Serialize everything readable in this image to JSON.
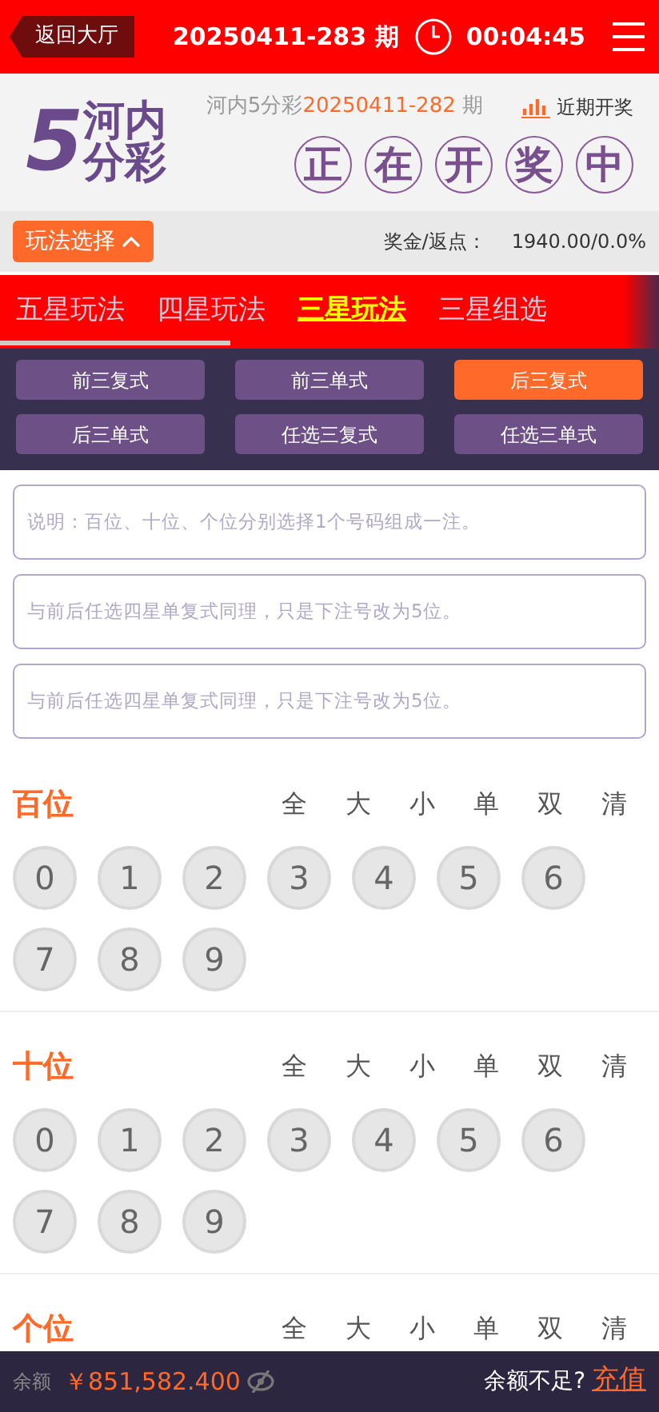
{
  "header": {
    "back": "返回大厅",
    "issue": "20250411-283 期",
    "countdown": "00:04:45"
  },
  "info": {
    "logo_digit": "5",
    "logo_top": "河内",
    "logo_bottom": "分彩",
    "lottery": "河内5分彩",
    "last_issue": "20250411-282",
    "last_suffix": " 期",
    "history": "近期开奖",
    "drawing": [
      "正",
      "在",
      "开",
      "奖",
      "中"
    ]
  },
  "bar": {
    "play_select": "玩法选择",
    "expanded": true,
    "prize_label": "奖金/返点：",
    "prize_value": "1940.00/0.0%"
  },
  "tabs": [
    {
      "label": "五星玩法",
      "selected": false
    },
    {
      "label": "四星玩法",
      "selected": false
    },
    {
      "label": "三星玩法",
      "selected": true
    },
    {
      "label": "三星组选",
      "selected": false
    }
  ],
  "subtypes": [
    {
      "label": "前三复式",
      "selected": false
    },
    {
      "label": "前三单式",
      "selected": false
    },
    {
      "label": "后三复式",
      "selected": true
    },
    {
      "label": "后三单式",
      "selected": false
    },
    {
      "label": "任选三复式",
      "selected": false
    },
    {
      "label": "任选三单式",
      "selected": false
    }
  ],
  "notes": [
    "说明：百位、十位、个位分别选择1个号码组成一注。",
    "与前后任选四星单复式同理，只是下注号改为5位。",
    "与前后任选四星单复式同理，只是下注号改为5位。"
  ],
  "positions": [
    {
      "title": "百位",
      "filters": [
        "全",
        "大",
        "小",
        "单",
        "双",
        "清"
      ],
      "digits": [
        {
          "label": "0",
          "selected": false
        },
        {
          "label": "1",
          "selected": false
        },
        {
          "label": "2",
          "selected": false
        },
        {
          "label": "3",
          "selected": false
        },
        {
          "label": "4",
          "selected": false
        },
        {
          "label": "5",
          "selected": false
        },
        {
          "label": "6",
          "selected": false
        },
        {
          "label": "7",
          "selected": false
        },
        {
          "label": "8",
          "selected": false
        },
        {
          "label": "9",
          "selected": false
        }
      ]
    },
    {
      "title": "十位",
      "filters": [
        "全",
        "大",
        "小",
        "单",
        "双",
        "清"
      ],
      "digits": [
        {
          "label": "0",
          "selected": false
        },
        {
          "label": "1",
          "selected": false
        },
        {
          "label": "2",
          "selected": false
        },
        {
          "label": "3",
          "selected": false
        },
        {
          "label": "4",
          "selected": false
        },
        {
          "label": "5",
          "selected": false
        },
        {
          "label": "6",
          "selected": false
        },
        {
          "label": "7",
          "selected": false
        },
        {
          "label": "8",
          "selected": false
        },
        {
          "label": "9",
          "selected": false
        }
      ]
    },
    {
      "title": "个位",
      "filters": [
        "全",
        "大",
        "小",
        "单",
        "双",
        "清"
      ]
    }
  ],
  "footer": {
    "balance_label": "余额",
    "balance": "￥851,582.400",
    "hint": "余额不足?",
    "recharge": "充值"
  }
}
